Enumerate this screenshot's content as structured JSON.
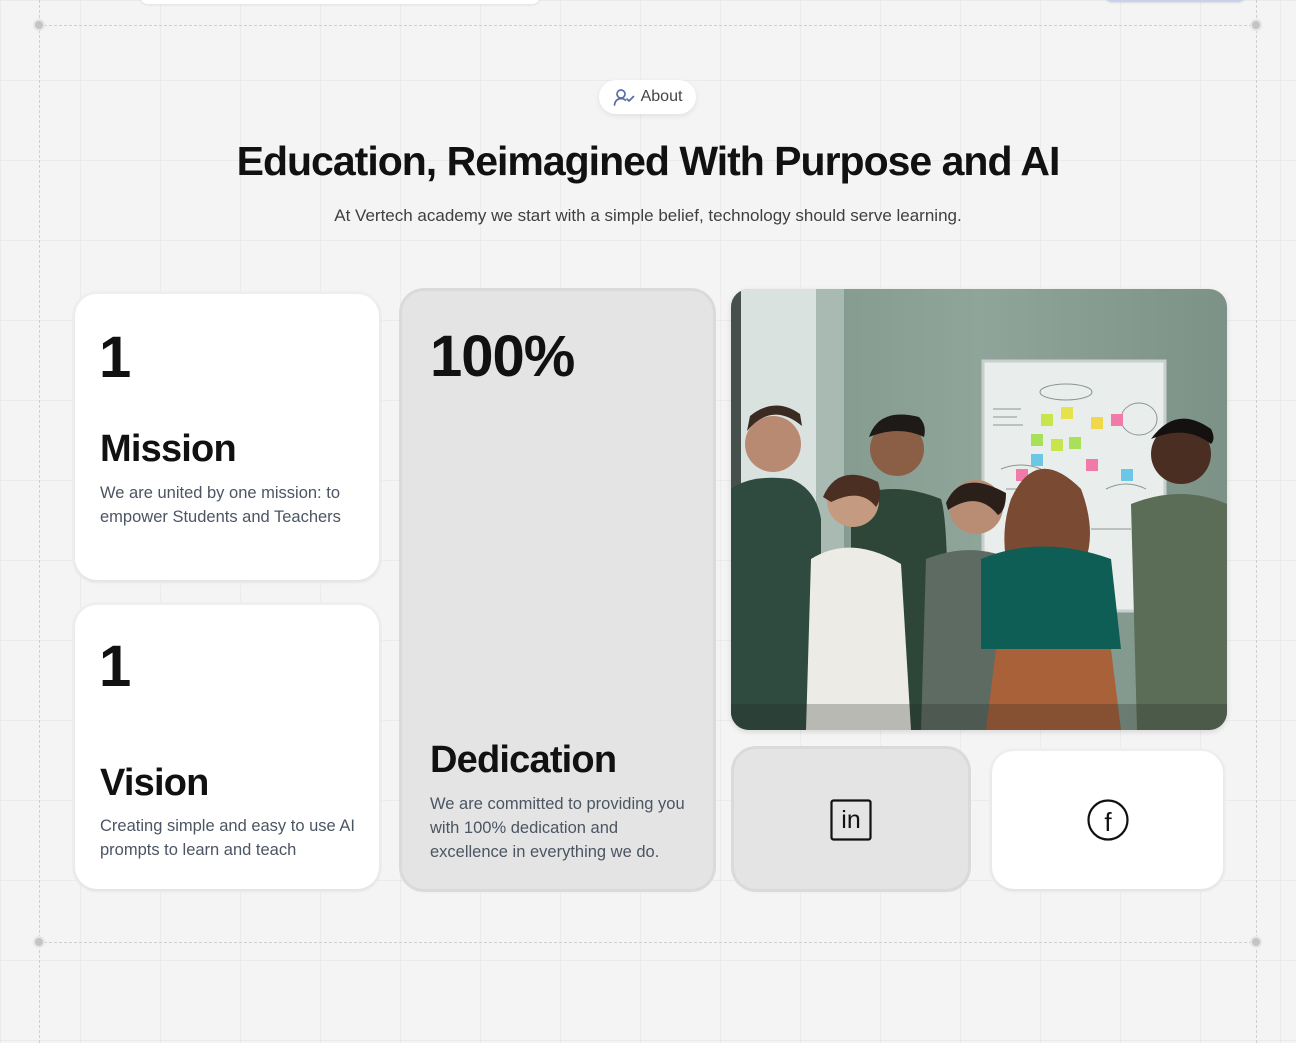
{
  "about_badge": {
    "label": "About",
    "icon": "user-check-icon"
  },
  "headline": "Education, Reimagined With Purpose and AI",
  "subheadline": "At Vertech academy we start with a simple belief, technology should serve learning.",
  "cards": {
    "mission": {
      "stat": "1",
      "title": "Mission",
      "description": "We are united by one mission: to empower Students and Teachers"
    },
    "vision": {
      "stat": "1",
      "title": "Vision",
      "description": "Creating simple and easy to use AI prompts to learn and teach"
    },
    "dedication": {
      "stat": "100%",
      "title": "Dedication",
      "description": "We are committed to providing you with 100% dedication and excellence in everything we do."
    }
  },
  "image": {
    "alt": "team-at-whiteboard-photo"
  },
  "social": [
    {
      "name": "linkedin-icon",
      "text": "in"
    },
    {
      "name": "facebook-icon",
      "text": "f"
    }
  ],
  "colors": {
    "background": "#f4f4f4",
    "card_white": "#ffffff",
    "card_grey": "#e4e4e4",
    "badge_icon": "#5a6aa8"
  }
}
